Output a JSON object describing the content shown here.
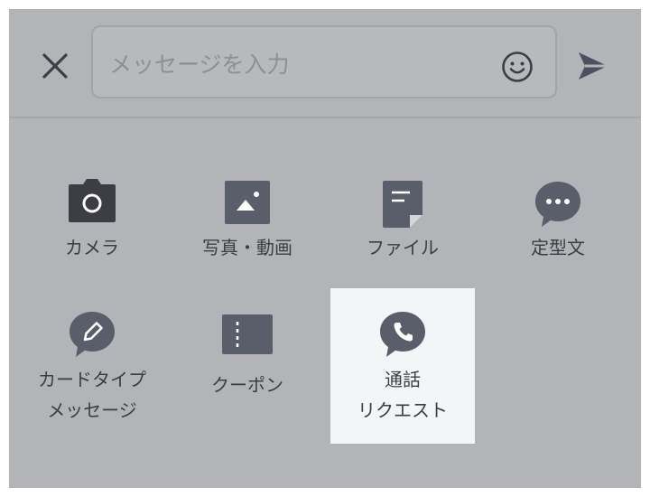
{
  "header": {
    "close_label": "close",
    "input_placeholder": "メッセージを入力"
  },
  "icons": {
    "close": "close-icon",
    "emoji": "smile-icon",
    "send": "send-icon"
  },
  "colors": {
    "panel_bg": "#b3b4b7",
    "icon_dark": "#3d3e45",
    "icon_slate": "#5a5d6a",
    "label_text": "#3c3d44",
    "highlight_bg": "#f4f5f7"
  },
  "menu": {
    "row1": [
      {
        "label": "カメラ",
        "icon": "camera-icon"
      },
      {
        "label": "写真・動画",
        "icon": "image-icon"
      },
      {
        "label": "ファイル",
        "icon": "file-icon"
      },
      {
        "label": "定型文",
        "icon": "chat-dots-icon"
      }
    ],
    "row2": [
      {
        "label_line1": "カードタイプ",
        "label_line2": "メッセージ",
        "icon": "pencil-bubble-icon"
      },
      {
        "label": "クーポン",
        "icon": "ticket-icon"
      },
      {
        "label_line1": "通話",
        "label_line2": "リクエスト",
        "icon": "phone-bubble-icon",
        "selected": true
      }
    ]
  }
}
